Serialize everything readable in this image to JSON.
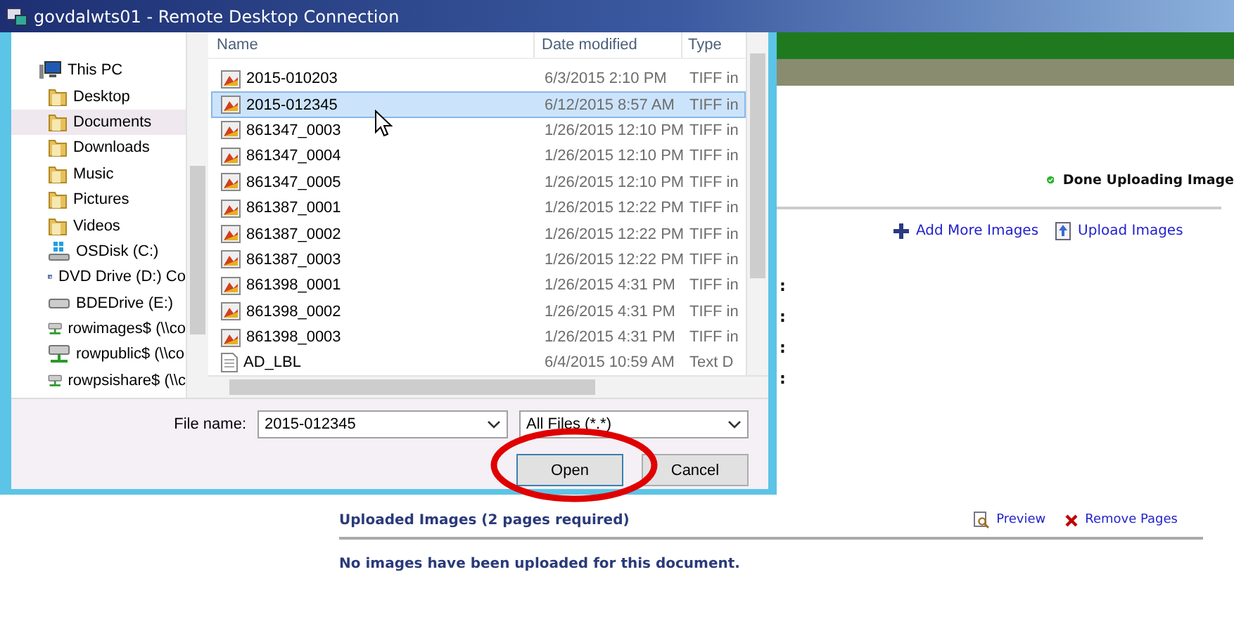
{
  "window": {
    "title": "govdalwts01 - Remote Desktop Connection"
  },
  "dialog": {
    "nav": [
      {
        "label": "This PC",
        "kind": "pc",
        "selected": false,
        "children": [
          {
            "label": "Desktop",
            "kind": "folder",
            "selected": false
          },
          {
            "label": "Documents",
            "kind": "folder",
            "selected": true
          },
          {
            "label": "Downloads",
            "kind": "folder",
            "selected": false
          },
          {
            "label": "Music",
            "kind": "folder",
            "selected": false
          },
          {
            "label": "Pictures",
            "kind": "folder",
            "selected": false
          },
          {
            "label": "Videos",
            "kind": "folder",
            "selected": false
          },
          {
            "label": "OSDisk (C:)",
            "kind": "osdisk",
            "selected": false
          },
          {
            "label": "DVD Drive (D:) Co",
            "kind": "dvd",
            "selected": false
          },
          {
            "label": "BDEDrive (E:)",
            "kind": "drive",
            "selected": false
          },
          {
            "label": "rowimages$ (\\\\co",
            "kind": "network",
            "selected": false
          },
          {
            "label": "rowpublic$ (\\\\co",
            "kind": "network",
            "selected": false
          },
          {
            "label": "rowpsishare$ (\\\\c",
            "kind": "network",
            "selected": false
          }
        ]
      }
    ],
    "columns": [
      "Name",
      "Date modified",
      "Type"
    ],
    "files": [
      {
        "name": "2015-010203",
        "date": "6/3/2015 2:10 PM",
        "type": "TIFF in",
        "kind": "image",
        "selected": false
      },
      {
        "name": "2015-012345",
        "date": "6/12/2015 8:57 AM",
        "type": "TIFF in",
        "kind": "image",
        "selected": true
      },
      {
        "name": "861347_0003",
        "date": "1/26/2015 12:10 PM",
        "type": "TIFF in",
        "kind": "image",
        "selected": false
      },
      {
        "name": "861347_0004",
        "date": "1/26/2015 12:10 PM",
        "type": "TIFF in",
        "kind": "image",
        "selected": false
      },
      {
        "name": "861347_0005",
        "date": "1/26/2015 12:10 PM",
        "type": "TIFF in",
        "kind": "image",
        "selected": false
      },
      {
        "name": "861387_0001",
        "date": "1/26/2015 12:22 PM",
        "type": "TIFF in",
        "kind": "image",
        "selected": false
      },
      {
        "name": "861387_0002",
        "date": "1/26/2015 12:22 PM",
        "type": "TIFF in",
        "kind": "image",
        "selected": false
      },
      {
        "name": "861387_0003",
        "date": "1/26/2015 12:22 PM",
        "type": "TIFF in",
        "kind": "image",
        "selected": false
      },
      {
        "name": "861398_0001",
        "date": "1/26/2015 4:31 PM",
        "type": "TIFF in",
        "kind": "image",
        "selected": false
      },
      {
        "name": "861398_0002",
        "date": "1/26/2015 4:31 PM",
        "type": "TIFF in",
        "kind": "image",
        "selected": false
      },
      {
        "name": "861398_0003",
        "date": "1/26/2015 4:31 PM",
        "type": "TIFF in",
        "kind": "image",
        "selected": false
      },
      {
        "name": "AD_LBL",
        "date": "6/4/2015 10:59 AM",
        "type": "Text D",
        "kind": "text",
        "selected": false
      }
    ],
    "file_name_label": "File name:",
    "file_name": "2015-012345",
    "filter": "All Files (*.*)",
    "buttons": [
      {
        "label": "Open",
        "kind": "default"
      },
      {
        "label": "Cancel",
        "kind": "normal"
      }
    ]
  },
  "page": {
    "status": "Done Uploading Image",
    "links": [
      {
        "label": "Add More Images",
        "kind": "add"
      },
      {
        "label": "Upload Images",
        "kind": "upload"
      }
    ],
    "field_colons": [
      ":",
      ":",
      ":",
      ":"
    ],
    "section": {
      "title": "Uploaded Images (2 pages required)",
      "actions": [
        {
          "label": "Preview",
          "kind": "preview"
        },
        {
          "label": "Remove Pages",
          "kind": "remove"
        }
      ],
      "message": "No images have been uploaded for this document."
    }
  }
}
